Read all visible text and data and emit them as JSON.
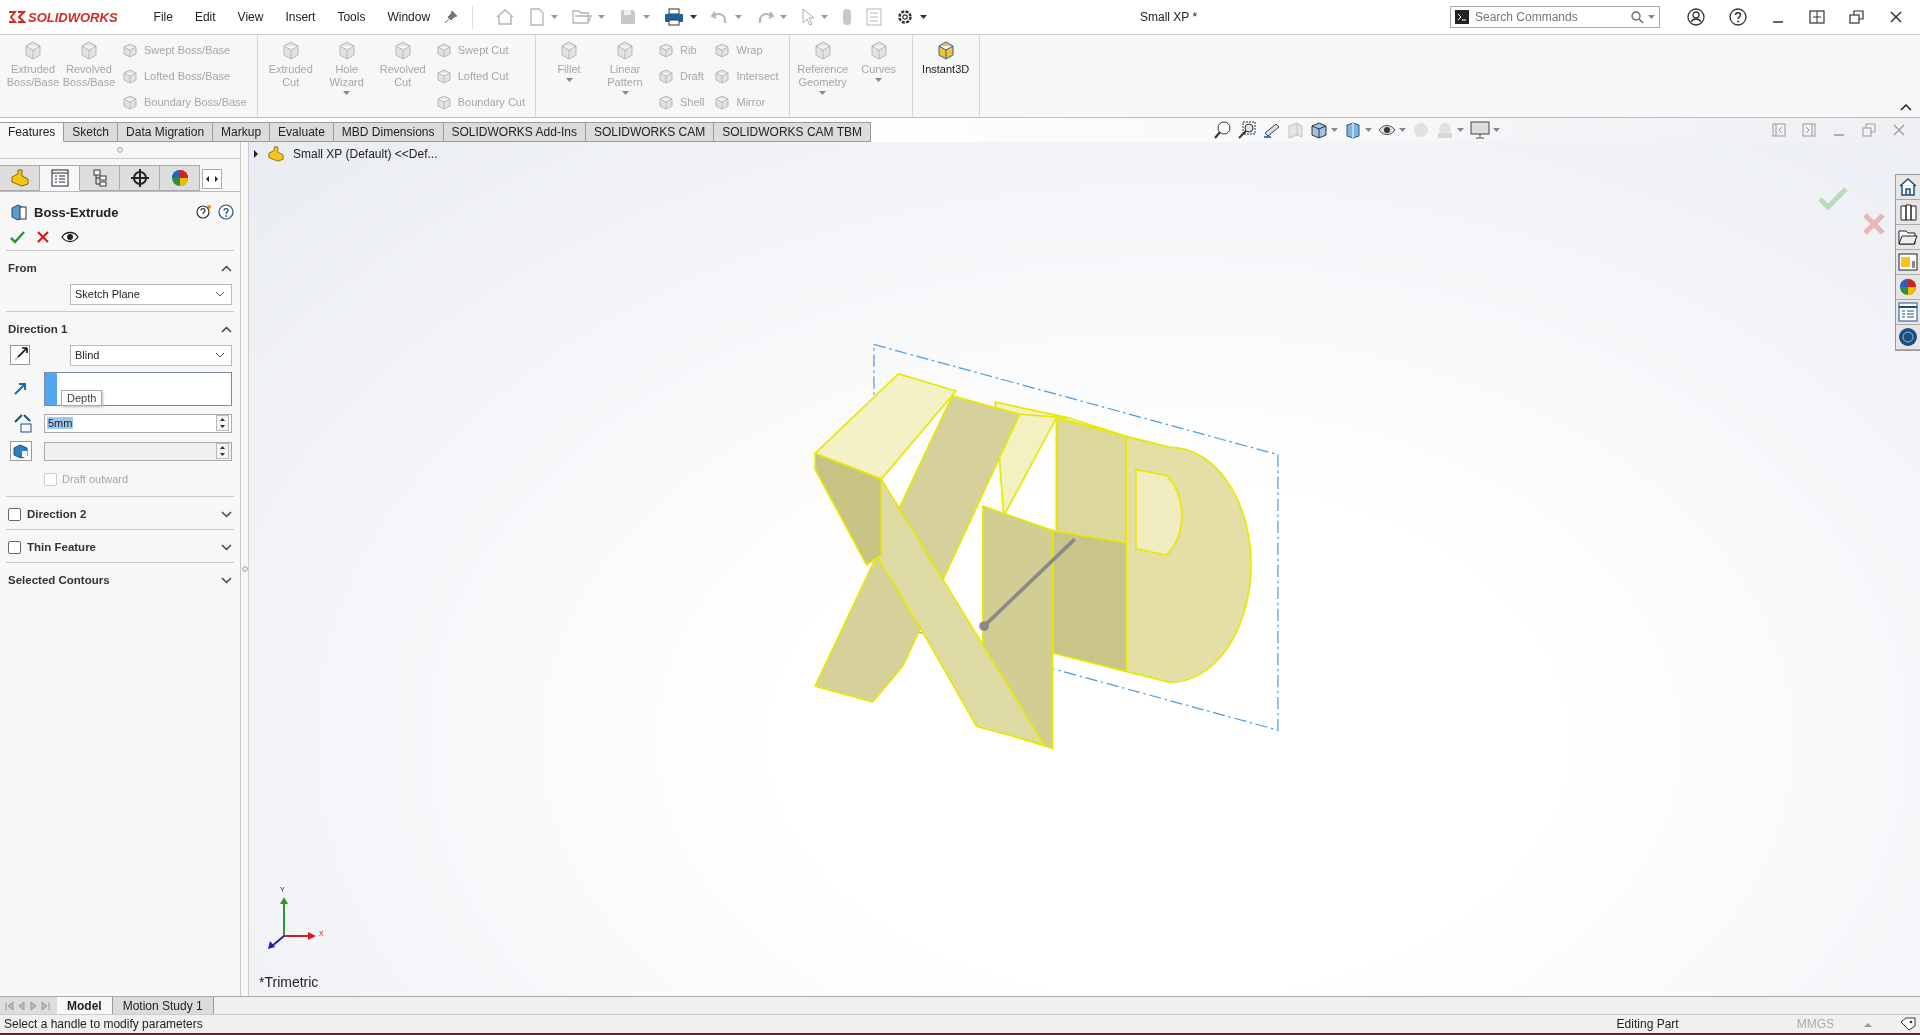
{
  "title_bar": {
    "logo": "SOLIDWORKS",
    "menu": [
      "File",
      "Edit",
      "View",
      "Insert",
      "Tools",
      "Window"
    ],
    "title": "Small XP *",
    "search": {
      "placeholder": "Search Commands"
    }
  },
  "ribbon": {
    "groups": [
      {
        "columns": [
          {
            "kind": "large",
            "label": "Extruded Boss/Base",
            "disabled": true,
            "caret": false
          },
          {
            "kind": "large",
            "label": "Revolved Boss/Base",
            "disabled": true,
            "caret": false
          },
          {
            "kind": "stack",
            "items": [
              {
                "label": "Swept Boss/Base",
                "disabled": true
              },
              {
                "label": "Lofted Boss/Base",
                "disabled": true
              },
              {
                "label": "Boundary Boss/Base",
                "disabled": true
              }
            ]
          }
        ]
      },
      {
        "columns": [
          {
            "kind": "large",
            "label": "Extruded Cut",
            "disabled": true,
            "caret": false
          },
          {
            "kind": "large",
            "label": "Hole Wizard",
            "disabled": true,
            "caret": true
          },
          {
            "kind": "large",
            "label": "Revolved Cut",
            "disabled": true,
            "caret": false
          },
          {
            "kind": "stack",
            "items": [
              {
                "label": "Swept Cut",
                "disabled": true
              },
              {
                "label": "Lofted Cut",
                "disabled": true
              },
              {
                "label": "Boundary Cut",
                "disabled": true
              }
            ]
          }
        ]
      },
      {
        "columns": [
          {
            "kind": "large",
            "label": "Fillet",
            "disabled": true,
            "caret": true
          },
          {
            "kind": "large",
            "label": "Linear Pattern",
            "disabled": true,
            "caret": true
          },
          {
            "kind": "stack",
            "items": [
              {
                "label": "Rib",
                "disabled": true
              },
              {
                "label": "Draft",
                "disabled": true
              },
              {
                "label": "Shell",
                "disabled": true
              }
            ]
          },
          {
            "kind": "stack",
            "items": [
              {
                "label": "Wrap",
                "disabled": true
              },
              {
                "label": "Intersect",
                "disabled": true
              },
              {
                "label": "Mirror",
                "disabled": true
              }
            ]
          }
        ]
      },
      {
        "columns": [
          {
            "kind": "large",
            "label": "Reference Geometry",
            "disabled": true,
            "caret": true
          },
          {
            "kind": "large",
            "label": "Curves",
            "disabled": true,
            "caret": true
          }
        ]
      },
      {
        "columns": [
          {
            "kind": "large",
            "label": "Instant3D",
            "disabled": false,
            "caret": false
          }
        ]
      }
    ]
  },
  "command_tabs": [
    {
      "label": "Features",
      "selected": true
    },
    {
      "label": "Sketch",
      "selected": false
    },
    {
      "label": "Data Migration",
      "selected": false
    },
    {
      "label": "Markup",
      "selected": false
    },
    {
      "label": "Evaluate",
      "selected": false
    },
    {
      "label": "MBD Dimensions",
      "selected": false
    },
    {
      "label": "SOLIDWORKS Add-Ins",
      "selected": false
    },
    {
      "label": "SOLIDWORKS CAM",
      "selected": false
    },
    {
      "label": "SOLIDWORKS CAM TBM",
      "selected": false
    }
  ],
  "panel_tabs": [
    {
      "kind": "feature-tree",
      "selected": false
    },
    {
      "kind": "property",
      "selected": true
    },
    {
      "kind": "configuration",
      "selected": false
    },
    {
      "kind": "dimxpert",
      "selected": false
    },
    {
      "kind": "display",
      "selected": false
    }
  ],
  "property_manager": {
    "title": "Boss-Extrude",
    "sections": [
      {
        "kind": "from",
        "title": "From",
        "expanded": true,
        "value": "Sketch Plane"
      },
      {
        "kind": "direction",
        "title": "Direction 1",
        "expanded": true,
        "end_condition": "Blind",
        "tooltip": "Depth",
        "depth": "5mm",
        "draft_outward": {
          "label": "Draft outward",
          "checked": false,
          "disabled": true
        }
      },
      {
        "kind": "checkbox",
        "title": "Direction 2",
        "checked": false,
        "expanded": false
      },
      {
        "kind": "checkbox",
        "title": "Thin Feature",
        "checked": false,
        "expanded": false
      },
      {
        "kind": "plain",
        "title": "Selected Contours",
        "expanded": false
      }
    ]
  },
  "viewport": {
    "tree_item": "Small XP (Default) <<Def...",
    "view_label": "*Trimetric",
    "triad": {
      "y": "Y",
      "x": "X"
    }
  },
  "bottom_tabs": [
    {
      "label": "Model",
      "selected": true
    },
    {
      "label": "Motion Study 1",
      "selected": false
    }
  ],
  "status_bar": {
    "message": "Select a handle to modify parameters",
    "mode": "Editing Part",
    "units": "MMGS"
  }
}
